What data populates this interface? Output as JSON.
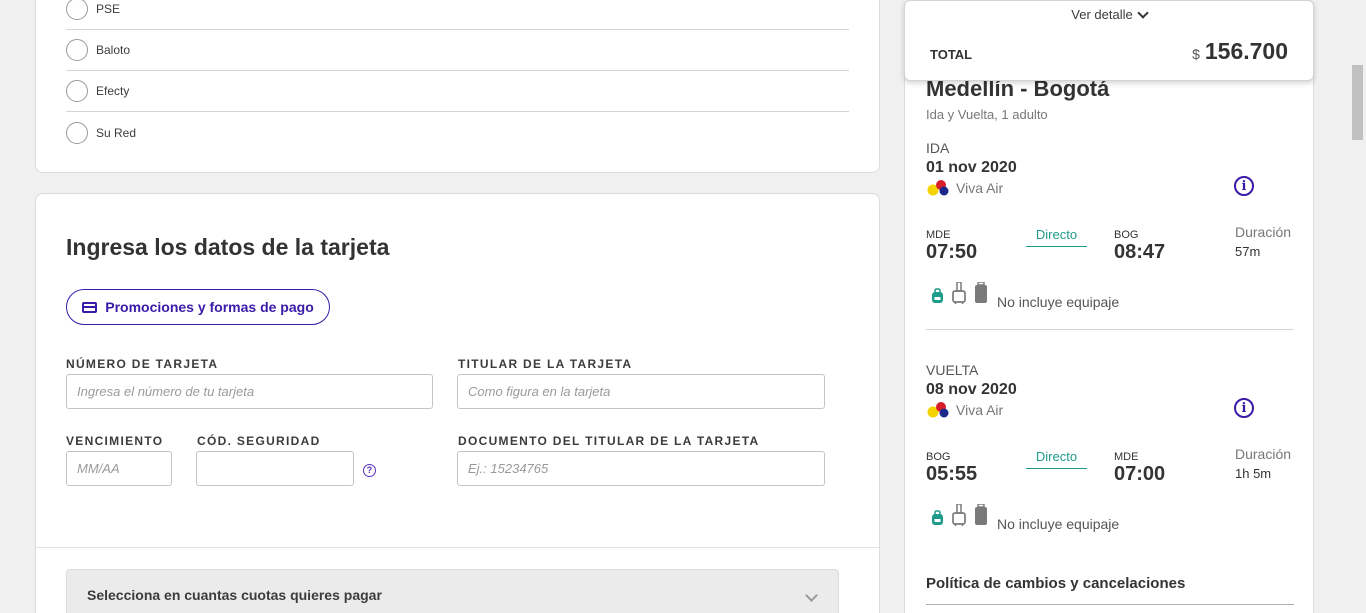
{
  "payment_methods": [
    {
      "label": "PSE"
    },
    {
      "label": "Baloto"
    },
    {
      "label": "Efecty"
    },
    {
      "label": "Su Red"
    }
  ],
  "card_form": {
    "title": "Ingresa los datos de la tarjeta",
    "promo_button": "Promociones y formas de pago",
    "card_number": {
      "label": "NÚMERO DE TARJETA",
      "placeholder": "Ingresa el número de tu tarjeta"
    },
    "card_holder": {
      "label": "TITULAR DE LA TARJETA",
      "placeholder": "Como figura en la tarjeta"
    },
    "expiry": {
      "label": "VENCIMIENTO",
      "placeholder": "MM/AA"
    },
    "security_code": {
      "label": "CÓD. SEGURIDAD",
      "placeholder": "",
      "help_icon": "?"
    },
    "holder_document": {
      "label": "DOCUMENTO DEL TITULAR DE LA TARJETA",
      "placeholder": "Ej.: 15234765"
    },
    "installments_label": "Selecciona en cuantas cuotas quieres pagar"
  },
  "summary": {
    "detail_toggle": "Ver detalle",
    "total_label": "TOTAL",
    "currency": "$",
    "total_value": "156.700",
    "route": "Medellín - Bogotá",
    "trip_info": "Ida y Vuelta, 1 adulto",
    "segments": [
      {
        "label": "IDA",
        "date": "01 nov 2020",
        "airline": "Viva Air",
        "from_code": "MDE",
        "from_time": "07:50",
        "stop_type": "Directo",
        "to_code": "BOG",
        "to_time": "08:47",
        "duration_label": "Duración",
        "duration": "57m",
        "baggage": "No incluye equipaje"
      },
      {
        "label": "VUELTA",
        "date": "08 nov 2020",
        "airline": "Viva Air",
        "from_code": "BOG",
        "from_time": "05:55",
        "stop_type": "Directo",
        "to_code": "MDE",
        "to_time": "07:00",
        "duration_label": "Duración",
        "duration": "1h 5m",
        "baggage": "No incluye equipaje"
      }
    ],
    "policy_title": "Política de cambios y cancelaciones"
  },
  "colors": {
    "brand_purple": "#3a1aa8",
    "direct_green": "#1e9b8a",
    "bag_teal": "#1e9b8a",
    "bag_gray": "#7a7a7a",
    "page_bg": "#f0f0f0"
  },
  "icons": {
    "info": "info-icon",
    "bag_small": "backpack-icon",
    "bag_cabin": "carry-on-icon",
    "bag_checked": "checked-bag-icon"
  }
}
